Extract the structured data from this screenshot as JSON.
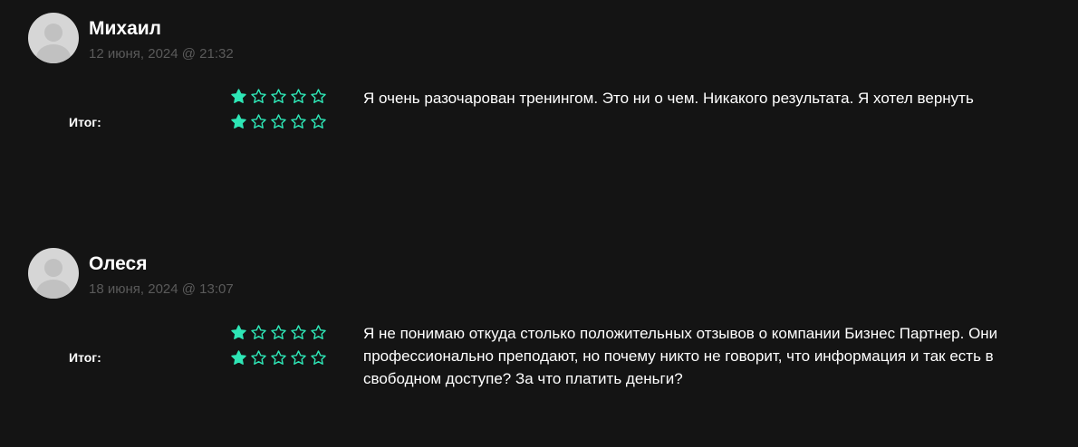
{
  "reviews": [
    {
      "author": "Михаил",
      "date": "12 июня, 2024 @ 21:32",
      "rating": 1,
      "total_rating": 1,
      "total_label": "Итог:",
      "text": "Я очень разочарован тренингом. Это ни о чем. Никакого результата. Я хотел вернуть"
    },
    {
      "author": "Олеся",
      "date": "18 июня, 2024 @ 13:07",
      "rating": 1,
      "total_rating": 1,
      "total_label": "Итог:",
      "text": "Я не понимаю откуда столько положительных отзывов о компании Бизнес Партнер. Они профессионально преподают, но почему никто не говорит, что информация и так есть в свободном доступе? За что платить деньги?"
    }
  ],
  "rating_max": 5,
  "colors": {
    "star": "#2ee5b5",
    "background": "#141414"
  },
  "icons": {
    "avatar": "user-placeholder-icon",
    "star_filled": "star-filled-icon",
    "star_empty": "star-outline-icon"
  }
}
